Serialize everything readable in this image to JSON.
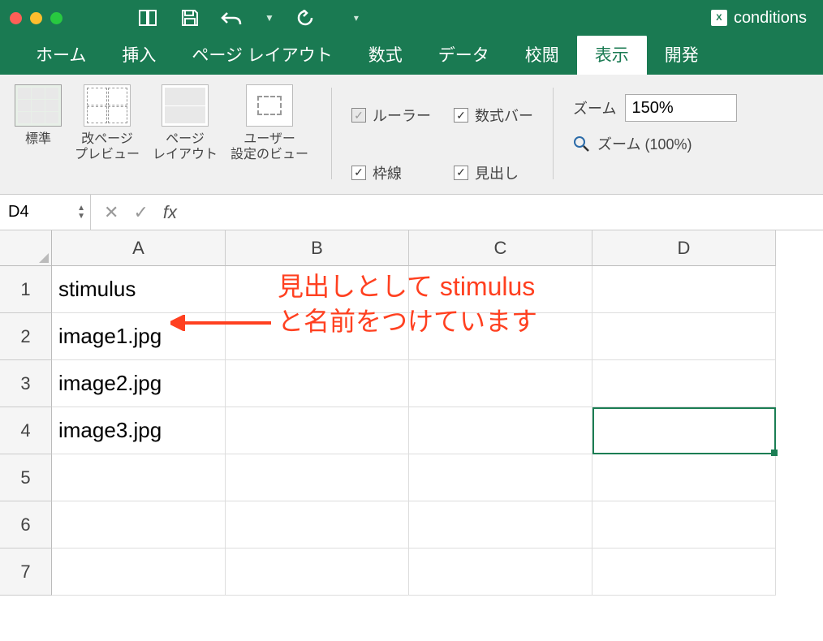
{
  "titlebar": {
    "filename": "conditions"
  },
  "tabs": {
    "home": "ホーム",
    "insert": "挿入",
    "layout": "ページ レイアウト",
    "formulas": "数式",
    "data": "データ",
    "review": "校閲",
    "view": "表示",
    "developer": "開発"
  },
  "ribbon": {
    "views": {
      "normal": "標準",
      "pagebreak": "改ページ\nプレビュー",
      "pagelayout": "ページ\nレイアウト",
      "custom": "ユーザー\n設定のビュー"
    },
    "checks": {
      "ruler": "ルーラー",
      "formulabar": "数式バー",
      "gridlines": "枠線",
      "headings": "見出し"
    },
    "zoom": {
      "label": "ズーム",
      "value": "150%",
      "reset": "ズーム (100%)"
    }
  },
  "namebox": {
    "ref": "D4"
  },
  "columns": {
    "A": "A",
    "B": "B",
    "C": "C",
    "D": "D"
  },
  "rows": [
    "1",
    "2",
    "3",
    "4",
    "5",
    "6",
    "7"
  ],
  "cells": {
    "A1": "stimulus",
    "A2": "image1.jpg",
    "A3": "image2.jpg",
    "A4": "image3.jpg"
  },
  "annotation": {
    "line1": "見出しとして stimulus",
    "line2": "と名前をつけています"
  }
}
